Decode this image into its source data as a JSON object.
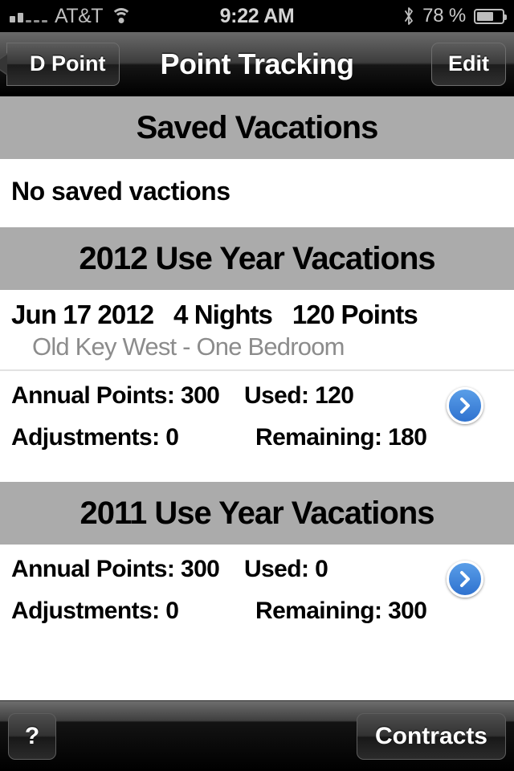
{
  "status_bar": {
    "carrier": "AT&T",
    "time": "9:22 AM",
    "battery_percent": "78 %",
    "signal_icon": "signal-bars-icon",
    "wifi_icon": "wifi-icon",
    "bluetooth_icon": "bluetooth-icon",
    "battery_icon": "battery-icon",
    "signal_bars_filled": 2,
    "signal_bars_total": 5,
    "battery_level": 78
  },
  "nav_bar": {
    "back_label": "D Point",
    "title": "Point Tracking",
    "edit_label": "Edit"
  },
  "sections": [
    {
      "header": "Saved Vacations",
      "empty_text": "No saved vactions",
      "type": "empty"
    },
    {
      "header": "2012 Use Year Vacations",
      "type": "year",
      "vacation": {
        "title": "Jun 17 2012   4 Nights   120 Points",
        "subtitle": "Old Key West - One Bedroom",
        "date": "Jun 17 2012",
        "nights": "4 Nights",
        "points": "120 Points",
        "resort": "Old Key West - One Bedroom"
      },
      "summary": {
        "annual_label": "Annual Points: 300",
        "used_label": "Used: 120",
        "adjustments_label": "Adjustments: 0",
        "remaining_label": "Remaining: 180",
        "annual_points": 300,
        "used": 120,
        "adjustments": 0,
        "remaining": 180
      },
      "disclosure_icon": "chevron-right-icon"
    },
    {
      "header": "2011 Use Year Vacations",
      "type": "year",
      "summary": {
        "annual_label": "Annual Points: 300",
        "used_label": "Used: 0",
        "adjustments_label": "Adjustments: 0",
        "remaining_label": "Remaining: 300",
        "annual_points": 300,
        "used": 0,
        "adjustments": 0,
        "remaining": 300
      },
      "disclosure_icon": "chevron-right-icon"
    }
  ],
  "toolbar": {
    "help_label": "?",
    "contracts_label": "Contracts"
  },
  "colors": {
    "section_header_bg": "#ababab",
    "disclosure_blue": "#2f72cf",
    "subtitle_gray": "#8c8c8c",
    "cell_bg": "#ffffff",
    "bar_black": "#000000"
  }
}
